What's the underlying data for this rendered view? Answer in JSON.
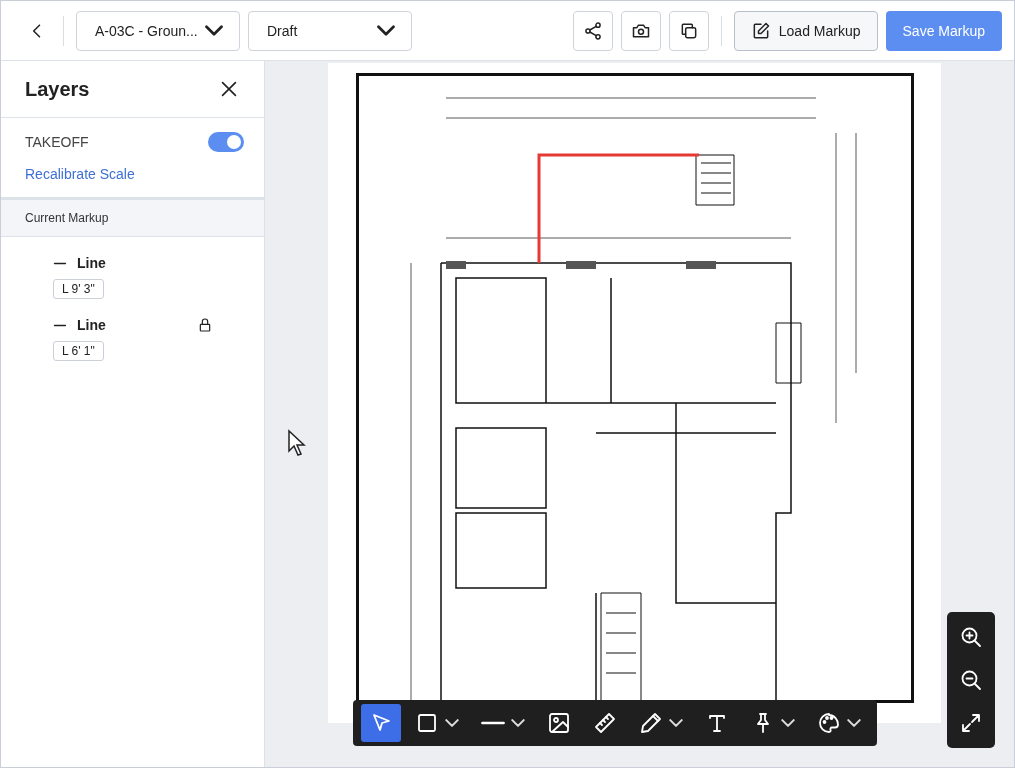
{
  "topbar": {
    "sheet": "A-03C - Groun...",
    "status": "Draft",
    "load_button": "Load Markup",
    "save_button": "Save Markup"
  },
  "layers": {
    "title": "Layers",
    "takeoff": {
      "label": "TAKEOFF",
      "on": true
    },
    "recalibrate_link": "Recalibrate Scale",
    "section": "Current Markup",
    "items": [
      {
        "name": "Line",
        "measure": "L 9' 3\"",
        "locked": false
      },
      {
        "name": "Line",
        "measure": "L 6' 1\"",
        "locked": true
      }
    ]
  },
  "tools": [
    {
      "kind": "select",
      "selected": true,
      "caret": false
    },
    {
      "kind": "rectangle",
      "selected": false,
      "caret": true
    },
    {
      "kind": "line",
      "selected": false,
      "caret": true
    },
    {
      "kind": "image",
      "selected": false,
      "caret": false
    },
    {
      "kind": "ruler",
      "selected": false,
      "caret": false
    },
    {
      "kind": "pencil",
      "selected": false,
      "caret": true
    },
    {
      "kind": "text",
      "selected": false,
      "caret": false
    },
    {
      "kind": "pin",
      "selected": false,
      "caret": true
    },
    {
      "kind": "palette",
      "selected": false,
      "caret": true
    }
  ]
}
